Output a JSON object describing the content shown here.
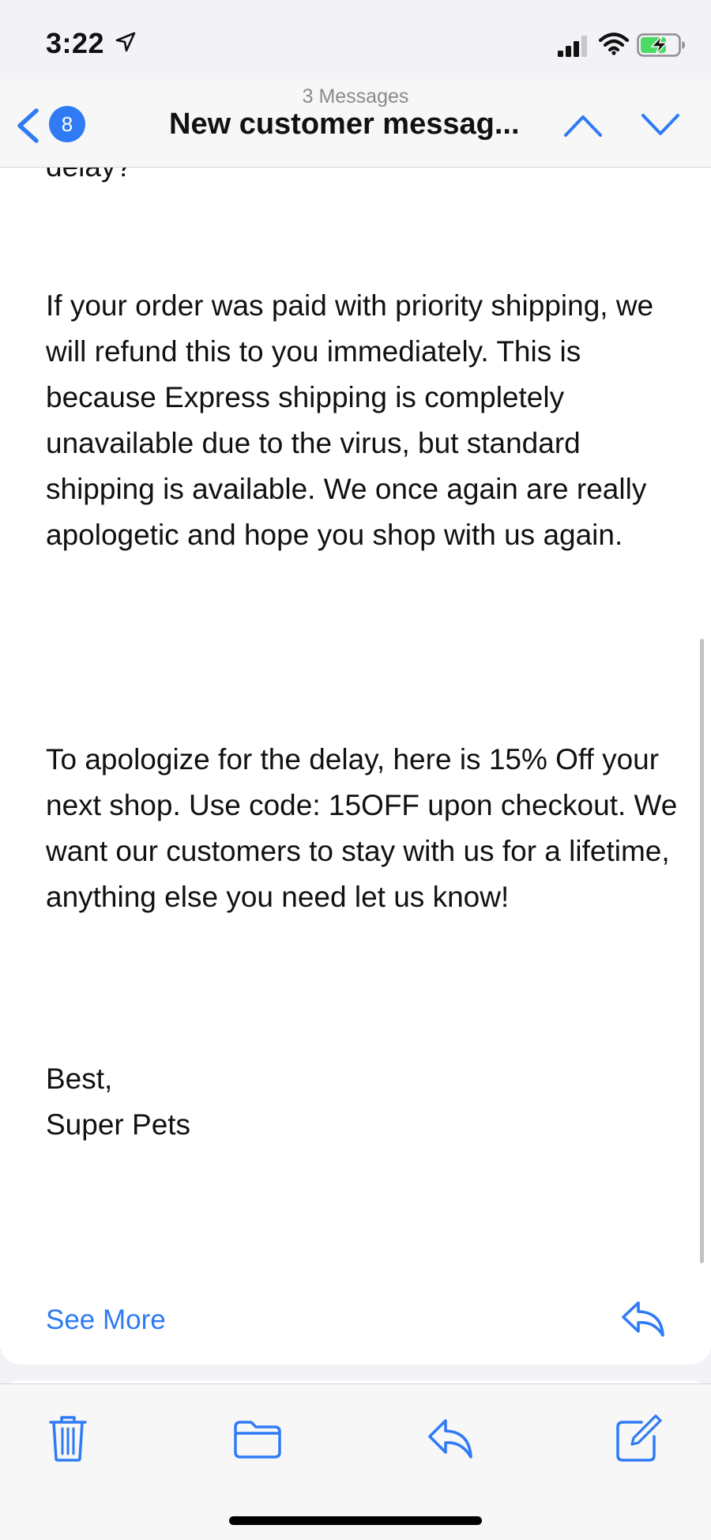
{
  "status_bar": {
    "time": "3:22",
    "icons": [
      "location-arrow-icon",
      "cellular-signal-icon",
      "wifi-icon",
      "battery-charging-icon"
    ]
  },
  "nav": {
    "back_badge": "8",
    "subtitle": "3 Messages",
    "title": "New customer messag...",
    "icons": [
      "back-chevron-icon",
      "chevron-up-icon",
      "chevron-down-icon"
    ]
  },
  "message": {
    "clipped_line": "delay?",
    "paragraph_1": "If your order was paid with priority shipping, we will refund this to you immediately. This is because Express shipping is completely unavailable due to the virus, but standard shipping is available. We once again are really apologetic and hope you shop with us again.",
    "paragraph_2": "To apologize for the delay, here is 15% Off your next shop. Use code: 15OFF upon checkout. We want our customers to stay with us for a lifetime, anything else you need let us know!",
    "sign_off": "Best,",
    "sender": "Super Pets",
    "see_more": "See More"
  },
  "toolbar": {
    "icons": [
      "trash-icon",
      "folder-icon",
      "reply-icon",
      "compose-icon"
    ]
  },
  "colors": {
    "accent": "#2f7bf5",
    "battery": "#4cd964",
    "background": "#f2f2f7"
  }
}
